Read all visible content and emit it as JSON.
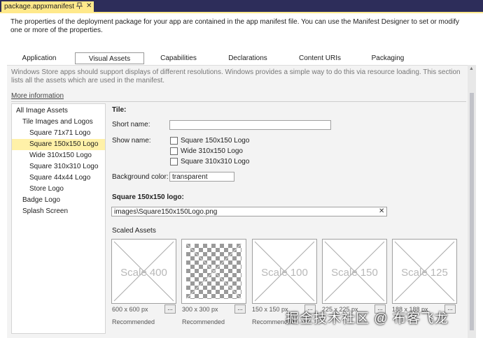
{
  "doc_tab": {
    "title": "package.appxmanifest",
    "pin_icon": "pin-icon",
    "close_glyph": "✕"
  },
  "description": "The properties of the deployment package for your app are contained in the app manifest file. You can use the Manifest Designer to set or modify one or more of the properties.",
  "tabs": [
    {
      "label": "Application",
      "selected": false
    },
    {
      "label": "Visual Assets",
      "selected": true
    },
    {
      "label": "Capabilities",
      "selected": false
    },
    {
      "label": "Declarations",
      "selected": false
    },
    {
      "label": "Content URIs",
      "selected": false
    },
    {
      "label": "Packaging",
      "selected": false
    }
  ],
  "pane": {
    "description": "Windows Store apps should support displays of different resolutions. Windows provides a simple way to do this via resource loading. This section lists all the assets which are used in the manifest.",
    "more_info": "More information"
  },
  "tree": [
    {
      "label": "All Image Assets",
      "level": 0,
      "selected": false
    },
    {
      "label": "Tile Images and Logos",
      "level": 1,
      "selected": false
    },
    {
      "label": "Square 71x71 Logo",
      "level": 2,
      "selected": false
    },
    {
      "label": "Square 150x150 Logo",
      "level": 2,
      "selected": true
    },
    {
      "label": "Wide 310x150 Logo",
      "level": 2,
      "selected": false
    },
    {
      "label": "Square 310x310 Logo",
      "level": 2,
      "selected": false
    },
    {
      "label": "Square 44x44 Logo",
      "level": 2,
      "selected": false
    },
    {
      "label": "Store Logo",
      "level": 2,
      "selected": false
    },
    {
      "label": "Badge Logo",
      "level": 1,
      "selected": false
    },
    {
      "label": "Splash Screen",
      "level": 1,
      "selected": false
    }
  ],
  "tile": {
    "heading": "Tile:",
    "short_name_label": "Short name:",
    "short_name_value": "",
    "show_name_label": "Show name:",
    "show_name_options": [
      {
        "label": "Square 150x150 Logo",
        "checked": false
      },
      {
        "label": "Wide 310x150 Logo",
        "checked": false
      },
      {
        "label": "Square 310x310 Logo",
        "checked": false
      }
    ],
    "bg_color_label": "Background color:",
    "bg_color_value": "transparent"
  },
  "logo": {
    "heading": "Square 150x150 logo:",
    "path_value": "images\\Square150x150Logo.png",
    "clear_glyph": "✕",
    "scaled_heading": "Scaled Assets"
  },
  "scaled_assets": [
    {
      "label": "Scale 400",
      "size": "600 x 600 px",
      "note": "Recommended",
      "filled": false
    },
    {
      "label": "",
      "size": "300 x 300 px",
      "note": "Recommended",
      "filled": true
    },
    {
      "label": "Scale 100",
      "size": "150 x 150 px",
      "note": "Recommended",
      "filled": false
    },
    {
      "label": "Scale 150",
      "size": "225 x 225 px",
      "note": "",
      "filled": false
    },
    {
      "label": "Scale 125",
      "size": "188 x 188 px",
      "note": "",
      "filled": false
    }
  ],
  "browse_label": "...",
  "watermark": "掘金技术社区 @ 布客飞龙"
}
